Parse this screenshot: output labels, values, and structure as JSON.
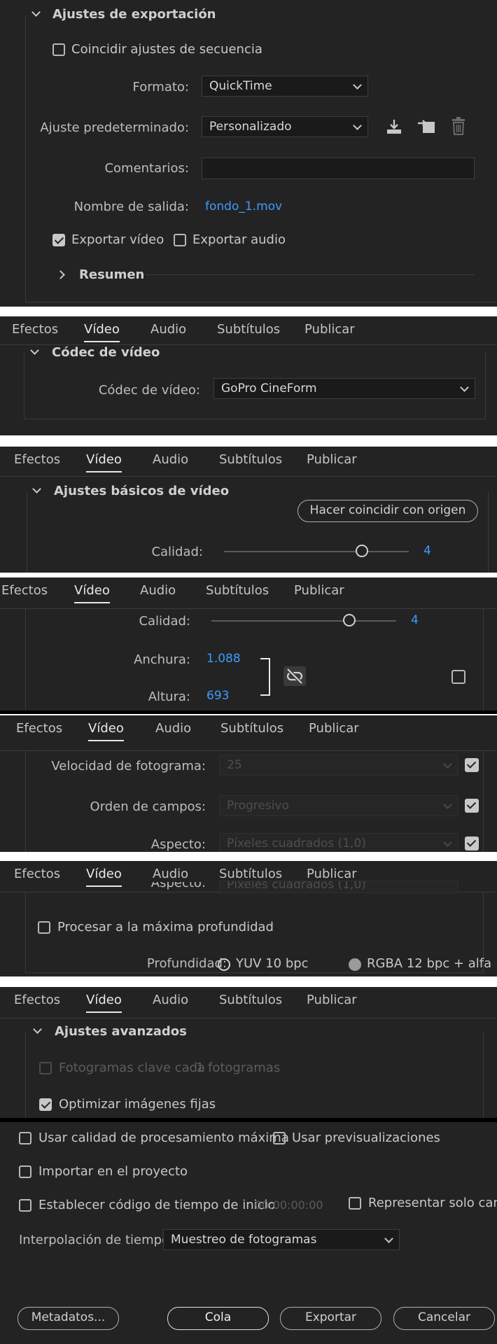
{
  "export_settings": {
    "header": "Ajustes de exportación",
    "match_sequence_label": "Coincidir ajustes de secuencia",
    "format_label": "Formato:",
    "format_value": "QuickTime",
    "preset_label": "Ajuste predeterminado:",
    "preset_value": "Personalizado",
    "comments_label": "Comentarios:",
    "comments_value": "",
    "output_name_label": "Nombre de salida:",
    "output_name_value": "fondo_1.mov",
    "export_video_label": "Exportar vídeo",
    "export_audio_label": "Exportar audio",
    "summary_label": "Resumen"
  },
  "tabs": [
    "Efectos",
    "Vídeo",
    "Audio",
    "Subtítulos",
    "Publicar"
  ],
  "active_tab": "Vídeo",
  "video_codec": {
    "header": "Códec de vídeo",
    "codec_label": "Códec de vídeo:",
    "codec_value": "GoPro CineForm"
  },
  "basic_video": {
    "header": "Ajustes básicos de vídeo",
    "match_source_button": "Hacer coincidir con origen",
    "quality_label": "Calidad:",
    "quality_value": "4",
    "width_label": "Anchura:",
    "width_value": "1.088",
    "height_label": "Altura:",
    "height_value": "693",
    "frame_rate_label": "Velocidad de fotograma:",
    "frame_rate_value": "25",
    "field_order_label": "Orden de campos:",
    "field_order_value": "Progresivo",
    "aspect_label": "Aspecto:",
    "aspect_value": "Píxeles cuadrados (1,0)",
    "render_max_depth_label": "Procesar a la máxima profundidad",
    "depth_label": "Profundidad:",
    "depth_option_1": "YUV 10 bpc",
    "depth_option_2": "RGBA 12 bpc + alfa"
  },
  "advanced": {
    "header": "Ajustes avanzados",
    "keyframes_label": "Fotogramas clave cada",
    "keyframes_value": "1",
    "keyframes_unit": "fotogramas",
    "optimize_stills_label": "Optimizar imágenes fijas"
  },
  "bottom": {
    "max_render_quality_label": "Usar calidad de procesamiento máxima",
    "use_previews_label": "Usar previsualizaciones",
    "import_into_project_label": "Importar en el proyecto",
    "set_start_timecode_label": "Establecer código de tiempo de inicio",
    "start_timecode_value": "00:00:00:00",
    "render_alpha_only_label": "Representar solo canal",
    "time_interpolation_label": "Interpolación de tiempo:",
    "time_interpolation_value": "Muestreo de fotogramas",
    "metadata_button": "Metadatos...",
    "queue_button": "Cola",
    "export_button": "Exportar",
    "cancel_button": "Cancelar"
  }
}
